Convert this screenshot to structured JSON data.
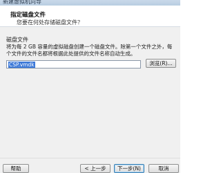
{
  "window": {
    "title": "新建虚拟机向导"
  },
  "header": {
    "title": "指定磁盘文件",
    "subtitle": "您要在何处存储磁盘文件？"
  },
  "disk_file": {
    "group_label": "磁盘文件",
    "description": "将为每 2 GB 容量的虚拟磁盘创建一个磁盘文件。除第一个文件之外，每个文件的文件名都将根据此处提供的文件名称自动生成。",
    "path_value": "CSP.vmdk",
    "browse_label": "浏览(R)..."
  },
  "footer": {
    "help_label": "帮助",
    "back_label": "< 上一步(B)",
    "next_label": "下一步(N) >",
    "cancel_label": "取消"
  }
}
